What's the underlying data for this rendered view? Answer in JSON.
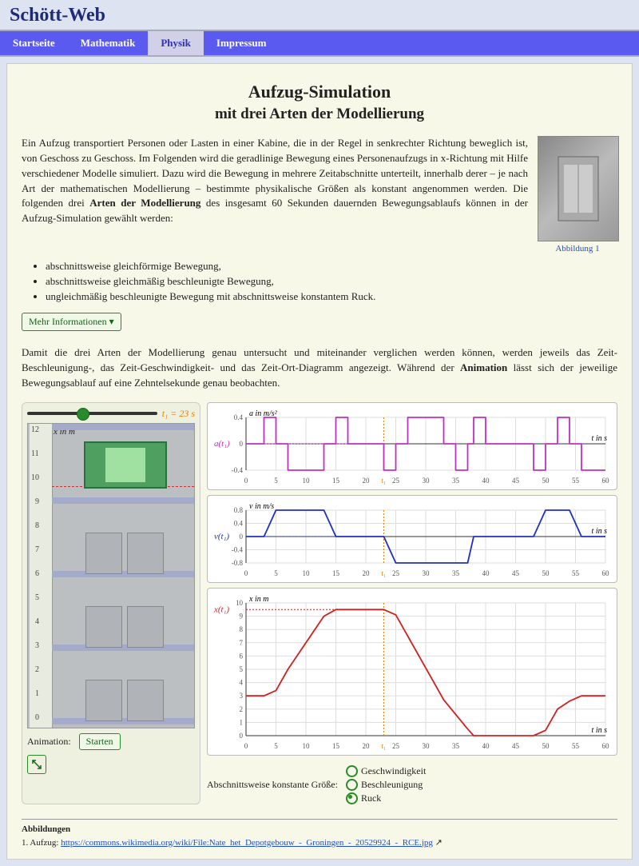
{
  "site_title": "Schött-Web",
  "nav": [
    "Startseite",
    "Mathematik",
    "Physik",
    "Impressum"
  ],
  "nav_active_index": 2,
  "heading": "Aufzug-Simulation",
  "subheading": "mit drei Arten der Modellierung",
  "intro": "Ein Aufzug transportiert Personen oder Lasten in einer Kabine, die in der Regel in senkrechter Richtung beweglich ist, von Geschoss zu Geschoss. Im Folgenden wird die geradlinige Bewegung eines Personenaufzugs in x-Richtung mit Hilfe verschiedener Modelle simuliert. Dazu wird die Bewegung in mehrere Zeitabschnitte unterteilt, innerhalb derer – je nach Art der mathematischen Modellierung – bestimmte physikalische Größen als konstant angenommen werden. Die folgenden drei Arten der Modellierung des insgesamt 60 Sekunden dauernden Bewegungsablaufs können in der Aufzug-Simulation gewählt werden:",
  "intro_bold": "Arten der Modellierung",
  "model_items": [
    "abschnittsweise gleichförmige Bewegung,",
    "abschnittsweise gleichmäßig beschleunigte Bewegung,",
    "ungleichmäßig beschleunigte Bewegung mit abschnittsweise konstantem Ruck."
  ],
  "fig_caption": "Abbildung 1",
  "more_info": "Mehr Informationen ▾",
  "para2_a": "Damit die drei Arten der Modellierung genau untersucht und miteinander verglichen werden können, werden jeweils das Zeit-Beschleunigung-, das Zeit-Geschwindigkeit- und das Zeit-Ort-Diagramm angezeigt. Während der ",
  "para2_bold": "Animation",
  "para2_b": " lässt sich der jeweilige Bewegungsablauf auf eine Zehntelsekunde genau beobachten.",
  "slider_label": "t₁ = 23 s",
  "y_axis_label": "x in m",
  "anim_label": "Animation:",
  "start_btn": "Starten",
  "radio_heading": "Abschnittsweise konstante Größe:",
  "radios": [
    "Geschwindigkeit",
    "Beschleunigung",
    "Ruck"
  ],
  "radio_selected_index": 2,
  "attrib_heading": "Abbildungen",
  "attrib_item_label": "1. Aufzug: ",
  "attrib_link": "https://commons.wikimedia.org/wiki/File:Nate_het_Depotgebouw_-_Groningen_-_20529924_-_RCE.jpg",
  "attrib_link_suffix": "↗",
  "chart_data": [
    {
      "type": "line",
      "title": "a(t₁)",
      "xlabel": "t in s",
      "ylabel": "a in m/s²",
      "xlim": [
        0,
        60
      ],
      "ylim": [
        -0.4,
        0.4
      ],
      "color": "#c030c0",
      "marker_t": 23,
      "marker_y": 0,
      "x": [
        0,
        3,
        3,
        5,
        5,
        7,
        7,
        13,
        13,
        15,
        15,
        17,
        17,
        23,
        23,
        25,
        25,
        27,
        27,
        33,
        33,
        35,
        35,
        37,
        37,
        38,
        38,
        40,
        40,
        48,
        48,
        50,
        50,
        52,
        52,
        54,
        54,
        56,
        56,
        60
      ],
      "y": [
        0,
        0,
        0.4,
        0.4,
        0,
        0,
        -0.4,
        -0.4,
        0,
        0,
        0.4,
        0.4,
        0,
        0,
        -0.4,
        -0.4,
        0,
        0,
        0.4,
        0.4,
        0,
        0,
        -0.4,
        -0.4,
        0,
        0,
        0.4,
        0.4,
        0,
        0,
        -0.4,
        -0.4,
        0,
        0,
        0.4,
        0.4,
        0,
        0,
        -0.4,
        -0.4
      ]
    },
    {
      "type": "line",
      "title": "v(t₁)",
      "xlabel": "t in s",
      "ylabel": "v in m/s",
      "xlim": [
        0,
        60
      ],
      "ylim": [
        -0.8,
        0.8
      ],
      "color": "#2030c0",
      "marker_t": 23,
      "marker_y": 0,
      "x": [
        0,
        3,
        5,
        7,
        13,
        15,
        17,
        23,
        25,
        27,
        33,
        35,
        37,
        38,
        40,
        48,
        50,
        52,
        54,
        56,
        60
      ],
      "y": [
        0,
        0,
        0.8,
        0.8,
        0.8,
        0,
        0,
        0,
        -0.8,
        -0.8,
        -0.8,
        -0.8,
        -0.8,
        0,
        0,
        0,
        0.8,
        0.8,
        0.8,
        0,
        0
      ]
    },
    {
      "type": "line",
      "title": "x(t₁)",
      "xlabel": "t in s",
      "ylabel": "x in m",
      "xlim": [
        0,
        60
      ],
      "ylim": [
        0,
        10
      ],
      "color": "#d02020",
      "marker_t": 23,
      "marker_y": 9.5,
      "x": [
        0,
        3,
        5,
        7,
        13,
        15,
        17,
        23,
        25,
        27,
        33,
        37,
        38,
        40,
        48,
        50,
        52,
        54,
        56,
        60
      ],
      "y": [
        3,
        3,
        3.4,
        5,
        9,
        9.5,
        9.5,
        9.5,
        9.1,
        7.5,
        2.7,
        0.5,
        0,
        0,
        0,
        0.4,
        2,
        2.6,
        3,
        3
      ]
    }
  ]
}
